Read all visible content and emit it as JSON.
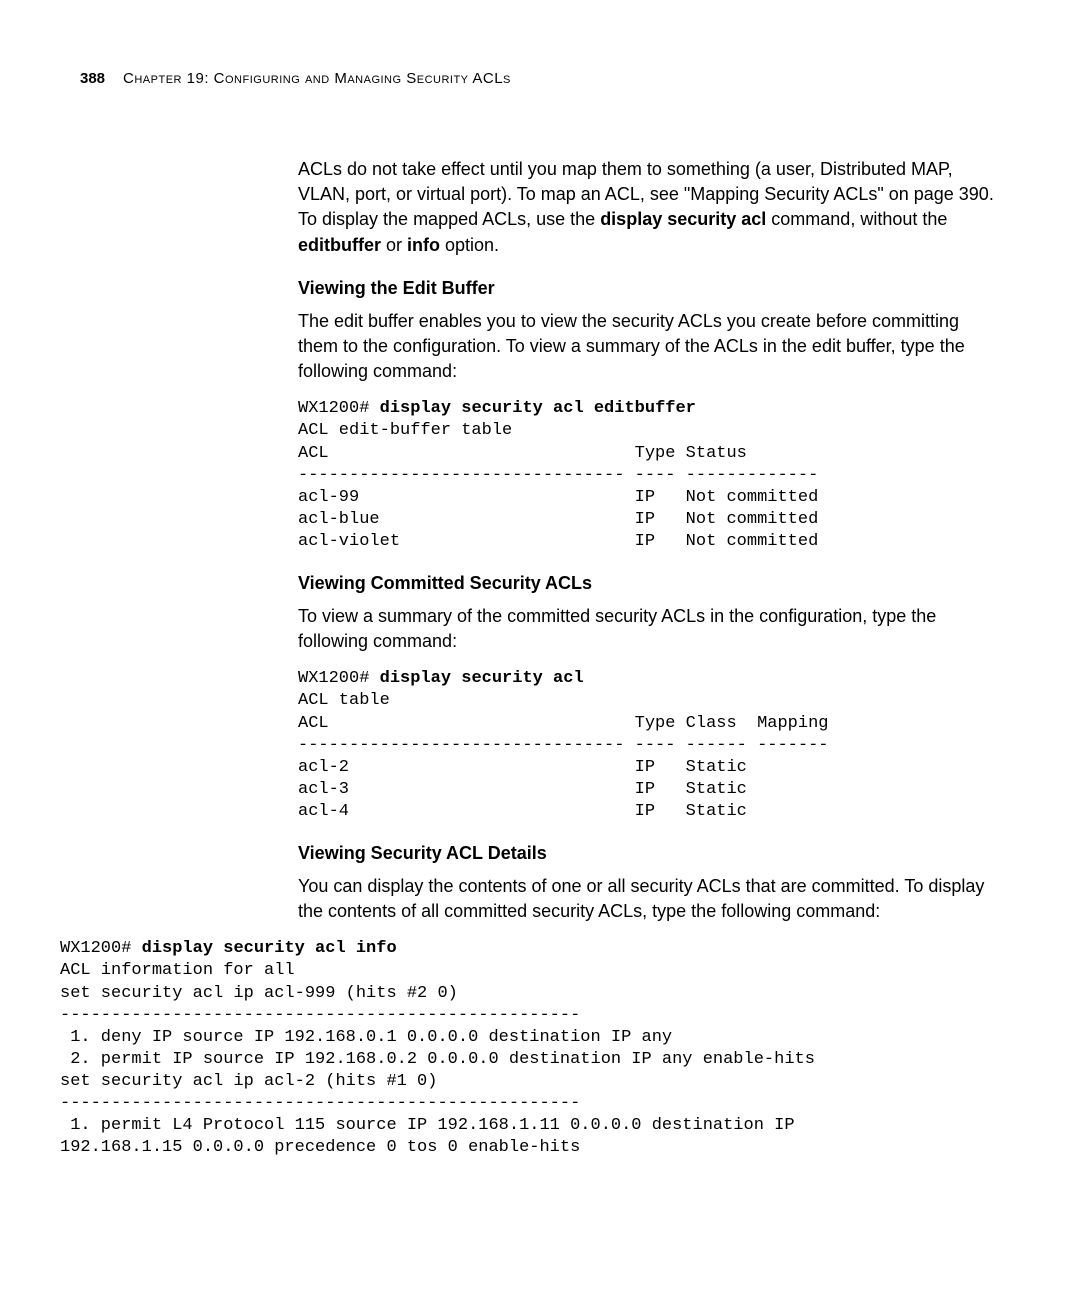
{
  "header": {
    "page_number": "388",
    "chapter": "Chapter 19: Configuring and Managing Security ACLs"
  },
  "intro_para": {
    "t1": "ACLs do not take effect until you map them to something (a user, Distributed MAP, VLAN, port, or virtual port). To map an ACL, see \"Mapping Security ACLs\" on page 390. To display the mapped ACLs, use the ",
    "b1": "display security acl",
    "t2": " command, without the ",
    "b2": "editbuffer",
    "t3": " or ",
    "b3": "info",
    "t4": " option."
  },
  "sec1": {
    "heading": "Viewing the Edit Buffer",
    "para": "The edit buffer enables you to view the security ACLs you create before committing them to the configuration. To view a summary of the ACLs in the edit buffer, type the following command:",
    "prompt": "WX1200# ",
    "cmd": "display security acl editbuffer",
    "output": "ACL edit-buffer table\nACL                              Type Status\n-------------------------------- ---- -------------\nacl-99                           IP   Not committed\nacl-blue                         IP   Not committed\nacl-violet                       IP   Not committed"
  },
  "sec2": {
    "heading": "Viewing Committed Security ACLs",
    "para": "To view a summary of the committed security ACLs in the configuration, type the following command:",
    "prompt": "WX1200# ",
    "cmd": "display security acl",
    "output": "ACL table\nACL                              Type Class  Mapping\n-------------------------------- ---- ------ -------\nacl-2                            IP   Static\nacl-3                            IP   Static\nacl-4                            IP   Static"
  },
  "sec3": {
    "heading": "Viewing Security ACL Details",
    "para": "You can display the contents of one or all security ACLs that are committed. To display the contents of all committed security ACLs, type the following command:",
    "prompt": "WX1200# ",
    "cmd": "display security acl info",
    "output": "ACL information for all\nset security acl ip acl-999 (hits #2 0)\n---------------------------------------------------\n 1. deny IP source IP 192.168.0.1 0.0.0.0 destination IP any\n 2. permit IP source IP 192.168.0.2 0.0.0.0 destination IP any enable-hits\nset security acl ip acl-2 (hits #1 0)\n---------------------------------------------------\n 1. permit L4 Protocol 115 source IP 192.168.1.11 0.0.0.0 destination IP\n192.168.1.15 0.0.0.0 precedence 0 tos 0 enable-hits"
  }
}
